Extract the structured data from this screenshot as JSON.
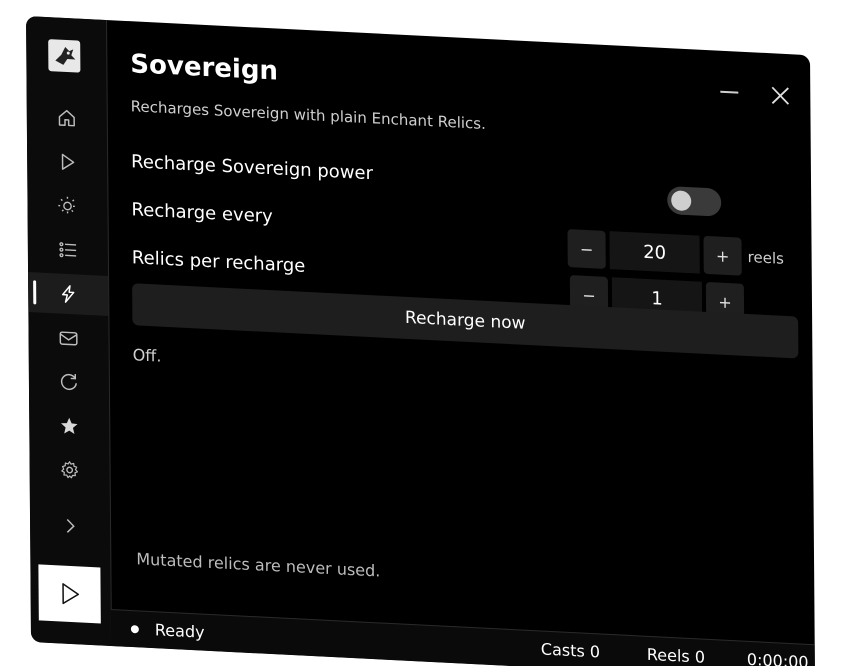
{
  "app": {
    "title": "Sovereign",
    "subtitle": "Recharges Sovereign with plain Enchant Relics."
  },
  "sidebar": {
    "items": [
      {
        "icon": "home-icon"
      },
      {
        "icon": "play-icon"
      },
      {
        "icon": "sun-icon"
      },
      {
        "icon": "list-icon"
      },
      {
        "icon": "lightning-icon",
        "active": true
      },
      {
        "icon": "mail-icon"
      },
      {
        "icon": "refresh-icon"
      },
      {
        "icon": "star-icon"
      },
      {
        "icon": "gear-icon"
      },
      {
        "icon": "chevron-right-icon"
      }
    ],
    "run_button_icon": "play-icon"
  },
  "settings": {
    "recharge_power_label": "Recharge Sovereign power",
    "recharge_power_enabled": false,
    "recharge_every_label": "Recharge every",
    "recharge_every_value": "20",
    "recharge_every_unit": "reels",
    "relics_per_recharge_label": "Relics per recharge",
    "relics_per_recharge_value": "1",
    "decrement_label": "−",
    "increment_label": "+"
  },
  "actions": {
    "recharge_now_label": "Recharge now"
  },
  "status_message": "Off.",
  "footnote": "Mutated relics are never used.",
  "statusbar": {
    "state": "Ready",
    "casts": "Casts 0",
    "reels": "Reels 0",
    "time": "0:00:00"
  },
  "colors": {
    "background": "#000000",
    "text": "#f2f2f2",
    "accent": "#ffffff"
  }
}
